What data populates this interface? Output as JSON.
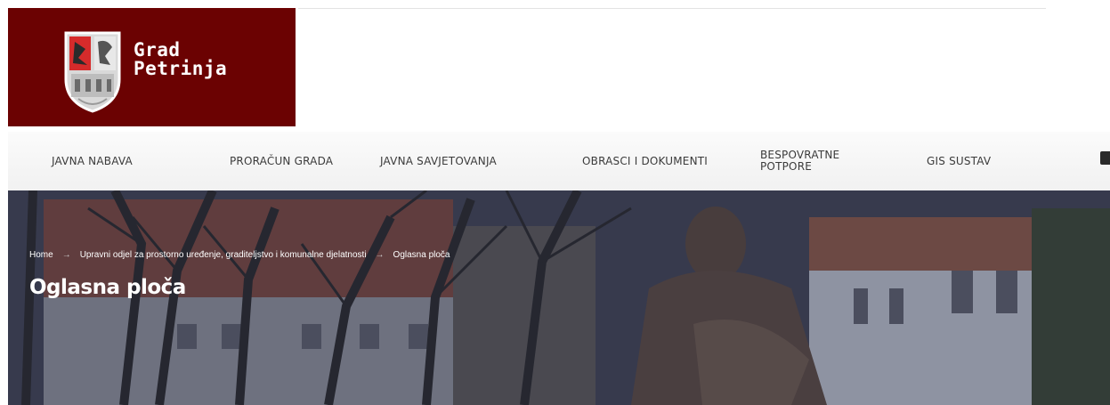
{
  "logo": {
    "line1": "Grad",
    "line2": "Petrinja"
  },
  "nav": {
    "items": [
      {
        "label": "JAVNA NABAVA"
      },
      {
        "label": "PRORAČUN GRADA"
      },
      {
        "label": "JAVNA SAVJETOVANJA"
      },
      {
        "label": "OBRASCI I DOKUMENTI"
      },
      {
        "label": "BESPOVRATNE POTPORE"
      },
      {
        "label": "GIS SUSTAV"
      }
    ]
  },
  "breadcrumb": {
    "home": "Home",
    "separator": "→",
    "section": "Upravni odjel za prostorno uređenje, graditeljstvo i komunalne djelatnosti",
    "current": "Oglasna ploča"
  },
  "hero": {
    "title": "Oglasna ploča"
  },
  "icons": {
    "crest": "coat-of-arms-icon",
    "social": "facebook-icon"
  },
  "colors": {
    "brand": "#6b0202",
    "nav_text": "#3b3b3b",
    "hero_text": "#ffffff"
  }
}
